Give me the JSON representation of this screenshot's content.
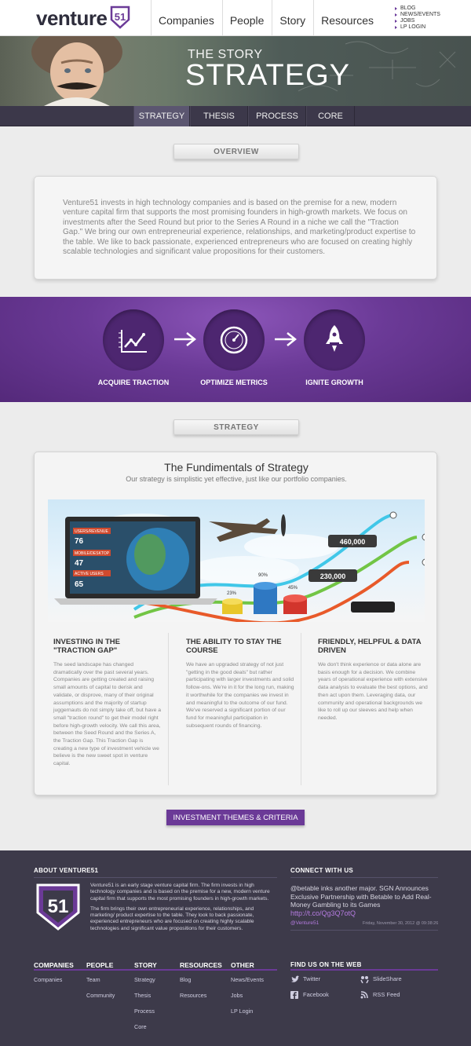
{
  "header": {
    "logo_text": "venture",
    "logo_num": "51",
    "nav": [
      "Companies",
      "People",
      "Story",
      "Resources"
    ],
    "util_nav": [
      "BLOG",
      "NEWS/EVENTS",
      "JOBS",
      "LP LOGIN"
    ]
  },
  "hero": {
    "subtitle": "THE STORY",
    "title": "STRATEGY"
  },
  "subnav": [
    "STRATEGY",
    "THESIS",
    "PROCESS",
    "CORE"
  ],
  "overview": {
    "label": "OVERVIEW",
    "text": "Venture51 invests in high technology companies and is based on the premise for a new, modern venture capital firm that supports the most promising founders in high-growth markets. We focus on investments after the Seed Round but prior to the Series A Round in a niche we call the \"Traction Gap.\" We bring our own entrepreneurial experience, relationships, and marketing/product expertise to the table. We like to back passionate, experienced entrepreneurs who are focused on creating highly scalable technologies and significant value propositions for their customers."
  },
  "steps": [
    "ACQUIRE TRACTION",
    "OPTIMIZE METRICS",
    "IGNITE GROWTH"
  ],
  "strategy": {
    "label": "STRATEGY",
    "title": "The Fundimentals of Strategy",
    "subtitle": "Our strategy is simplistic yet effective, just like our portfolio companies.",
    "stage": {
      "laptop_rows": [
        {
          "label": "USERS/REVENUE",
          "value": "76"
        },
        {
          "label": "MOBILE/DESKTOP",
          "value": "47"
        },
        {
          "label": "ACTIVE USERS",
          "value": "65"
        }
      ],
      "bubbles": [
        "460,000",
        "230,000"
      ],
      "bar_labels": [
        "23%",
        "90%",
        "45%"
      ]
    },
    "columns": [
      {
        "title": "INVESTING IN THE \"TRACTION GAP\"",
        "text": "The seed landscape has changed dramatically over the past several years. Companies are getting created and raising small amounts of capital to derisk and validate, or disprove, many of their original assumptions and the majority of startup juggernauts do not simply take off, but have a small \"traction round\" to get their model right before high-growth velocity. We call this area, between the Seed Round and the Series A, the Traction Gap. This Traction Gap is creating a new type of investment vehicle we believe is the new sweet spot in venture capital."
      },
      {
        "title": "THE ABILITY TO STAY THE COURSE",
        "text": "We have an upgraded strategy of not just \"getting in the good deals\" but rather participating with larger investments and solid follow-ons. We're in it for the long run, making it worthwhile for the companies we invest in and meaningful to the outcome of our fund. We've reserved a significant portion of our fund for meaningful participation in subsequent rounds of financing."
      },
      {
        "title": "FRIENDLY, HELPFUL & DATA DRIVEN",
        "text": "We don't think experience or data alone are basis enough for a decision. We combine years of operational experience with extensive data analysis to evaluate the best options, and then act upon them. Leveraging data, our community and operational backgrounds we like to roll up our sleeves and help when needed."
      }
    ],
    "cta": "INVESTMENT THEMES & CRITERIA"
  },
  "footer": {
    "about_title": "ABOUT VENTURE51",
    "about_p1": "Venture51 is an early stage venture capital firm. The firm invests in high technology companies and is based on the premise for a new, modern venture capital firm that supports the most promising founders in high-growth markets.",
    "about_p2": "The firm brings their own entrepreneurial experience, relationships, and marketing/ product expertise to the table. They look to back passionate, experienced entrepreneurs who are focused on creating highly scalable technologies and significant value propositions for their customers.",
    "connect_title": "CONNECT WITH US",
    "tweet": "@betable inks another major. SGN Announces Exclusive Partnership with Betable to Add Real-Money Gambling to its Games",
    "tweet_link": "http://t.co/Qg3Q7otQ",
    "tweet_user": "@Venture51",
    "tweet_date": "Friday, November 30, 2012 @ 09:38:26",
    "find_title": "FIND US ON THE WEB",
    "social": [
      "Twitter",
      "SlideShare",
      "Facebook",
      "RSS Feed"
    ],
    "cols": [
      {
        "title": "COMPANIES",
        "links": [
          "Companies"
        ]
      },
      {
        "title": "PEOPLE",
        "links": [
          "Team",
          "Community"
        ]
      },
      {
        "title": "STORY",
        "links": [
          "Strategy",
          "Thesis",
          "Process",
          "Core"
        ]
      },
      {
        "title": "RESOURCES",
        "links": [
          "Blog",
          "Resources"
        ]
      },
      {
        "title": "OTHER",
        "links": [
          "News/Events",
          "Jobs",
          "LP Login"
        ]
      }
    ]
  }
}
